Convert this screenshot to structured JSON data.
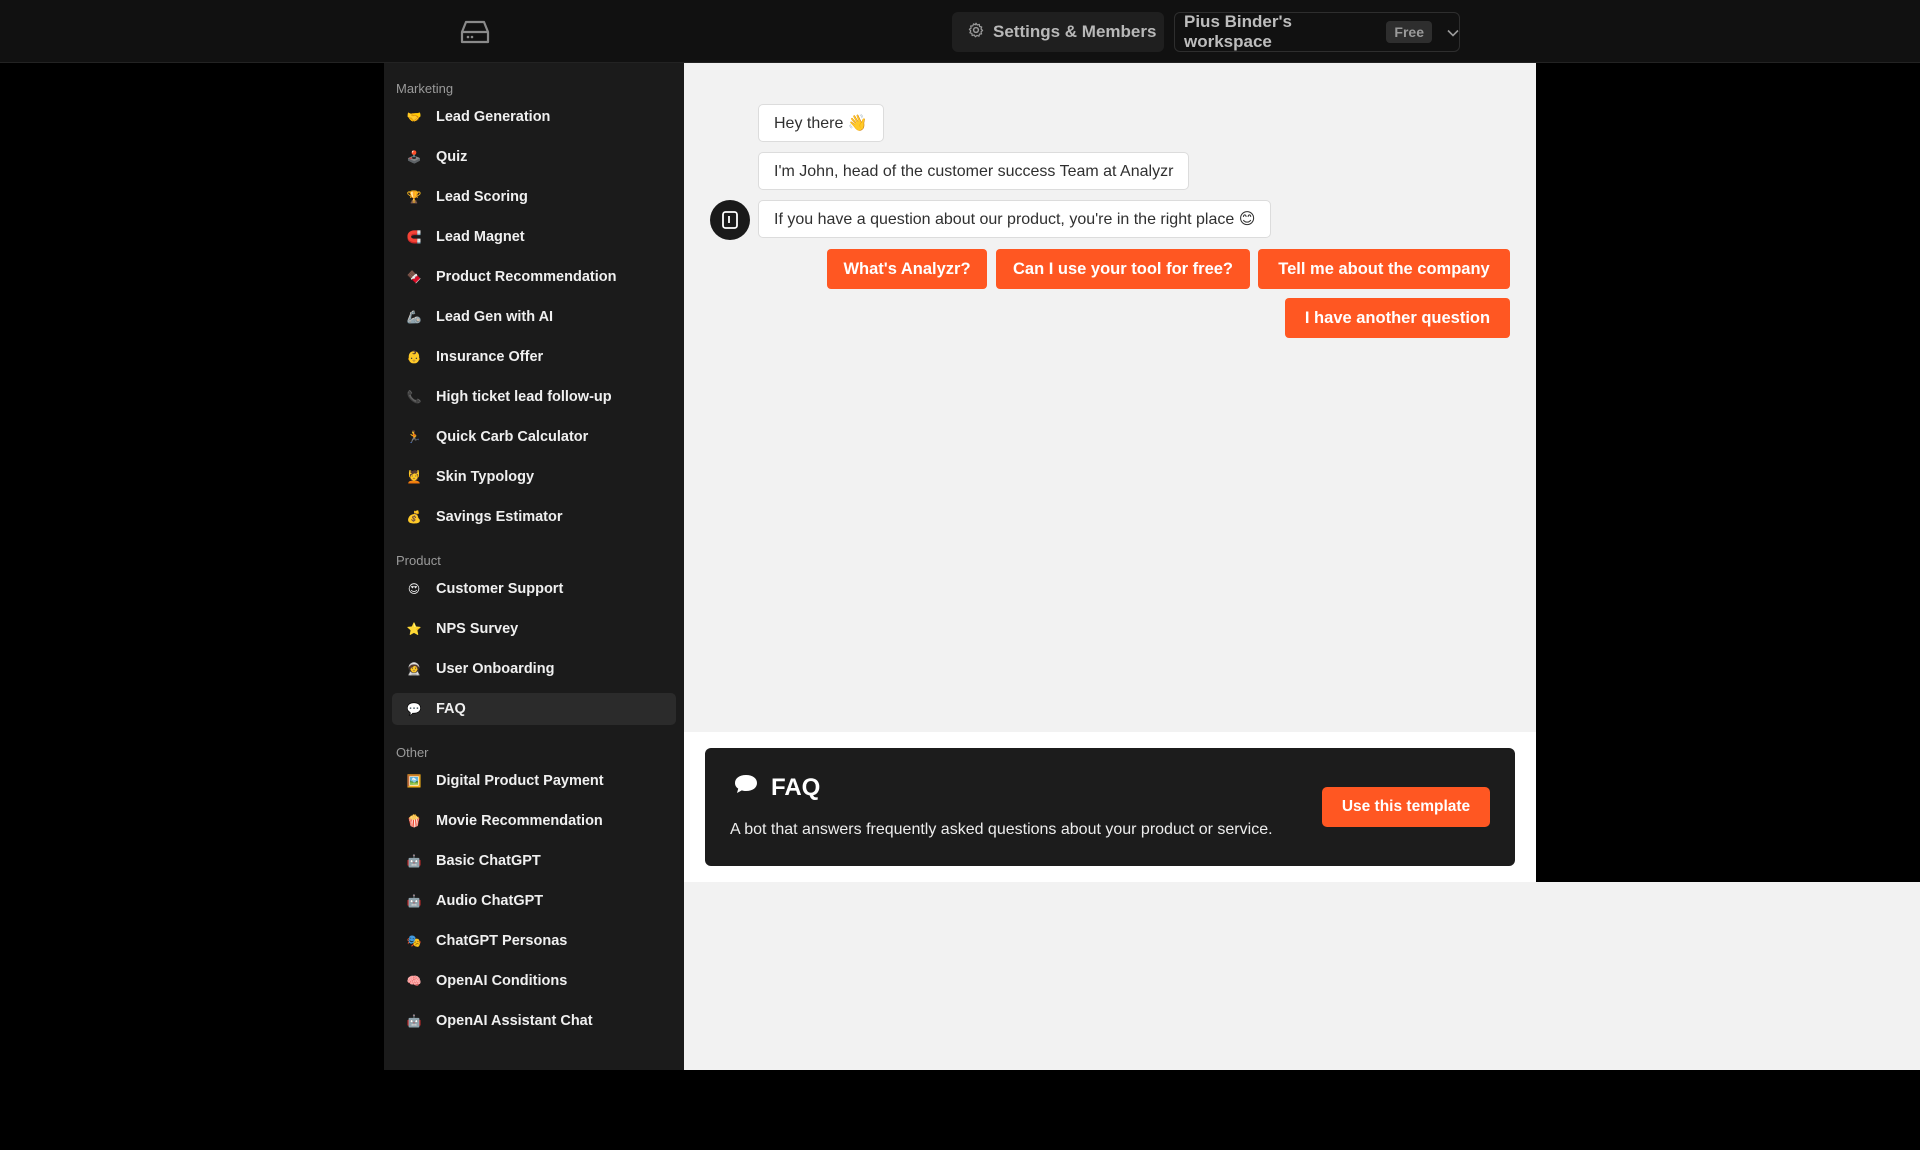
{
  "topbar": {
    "logo_icon": "inbox-tray-icon",
    "settings_label": "Settings & Members",
    "workspace_name": "Pius Binder's workspace",
    "plan_badge": "Free"
  },
  "sidebar": {
    "sections": [
      {
        "label": "Marketing",
        "items": [
          {
            "label": "Lead Generation",
            "icon": "🤝"
          },
          {
            "label": "Quiz",
            "icon": "🕹️"
          },
          {
            "label": "Lead Scoring",
            "icon": "🏆"
          },
          {
            "label": "Lead Magnet",
            "icon": "🧲"
          },
          {
            "label": "Product Recommendation",
            "icon": "🍫"
          },
          {
            "label": "Lead Gen with AI",
            "icon": "🦾"
          },
          {
            "label": "Insurance Offer",
            "icon": "👶"
          },
          {
            "label": "High ticket lead follow-up",
            "icon": "📞"
          },
          {
            "label": "Quick Carb Calculator",
            "icon": "🏃"
          },
          {
            "label": "Skin Typology",
            "icon": "💆"
          },
          {
            "label": "Savings Estimator",
            "icon": "💰"
          }
        ]
      },
      {
        "label": "Product",
        "items": [
          {
            "label": "Customer Support",
            "icon": "😍"
          },
          {
            "label": "NPS Survey",
            "icon": "⭐"
          },
          {
            "label": "User Onboarding",
            "icon": "🧑‍🚀"
          },
          {
            "label": "FAQ",
            "icon": "💬",
            "active": true
          }
        ]
      },
      {
        "label": "Other",
        "items": [
          {
            "label": "Digital Product Payment",
            "icon": "🖼️"
          },
          {
            "label": "Movie Recommendation",
            "icon": "🍿"
          },
          {
            "label": "Basic ChatGPT",
            "icon": "🤖"
          },
          {
            "label": "Audio ChatGPT",
            "icon": "🤖"
          },
          {
            "label": "ChatGPT Personas",
            "icon": "🎭"
          },
          {
            "label": "OpenAI Conditions",
            "icon": "🧠"
          },
          {
            "label": "OpenAI Assistant Chat",
            "icon": "🤖"
          }
        ]
      }
    ]
  },
  "chat": {
    "messages": [
      "Hey there 👋",
      "I'm John, head of the customer success Team at Analyzr",
      "If you have a question about our product, you're in the right place 😊"
    ],
    "choices": [
      "What's Analyzr?",
      "Can I use your tool for free?",
      "Tell me about the company",
      "I have another question"
    ]
  },
  "template_card": {
    "icon": "💬",
    "title": "FAQ",
    "description": "A bot that answers frequently asked questions about your product or service.",
    "button_label": "Use this template"
  },
  "colors": {
    "accent": "#ff5722",
    "sidebar_bg": "#1b1b1b",
    "preview_bg": "#f2f2f2"
  }
}
